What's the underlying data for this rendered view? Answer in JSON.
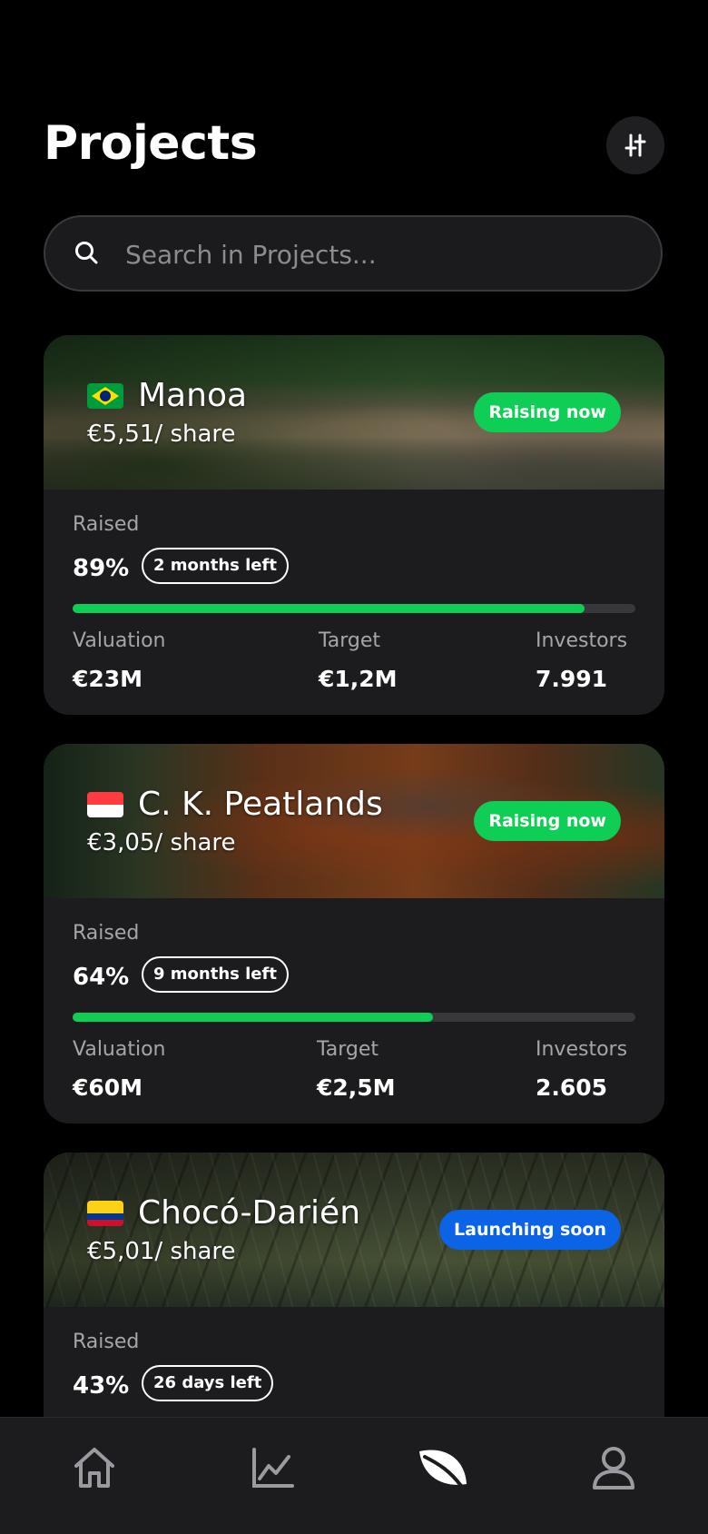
{
  "header": {
    "title": "Projects"
  },
  "search": {
    "placeholder": "Search in Projects..."
  },
  "projects": [
    {
      "name": "Manoa",
      "price": "€5,51/ share",
      "status": "Raising now",
      "status_color": "#0fce56",
      "flag": "brazil",
      "raised_label": "Raised",
      "raised_pct": "89%",
      "raised_fraction": 0.91,
      "time_left": "2 months left",
      "valuation_label": "Valuation",
      "valuation": "€23M",
      "target_label": "Target",
      "target": "€1,2M",
      "investors_label": "Investors",
      "investors": "7.991"
    },
    {
      "name": "C. K. Peatlands",
      "price": "€3,05/ share",
      "status": "Raising now",
      "status_color": "#0fce56",
      "flag": "indonesia",
      "raised_label": "Raised",
      "raised_pct": "64%",
      "raised_fraction": 0.64,
      "time_left": "9 months left",
      "valuation_label": "Valuation",
      "valuation": "€60M",
      "target_label": "Target",
      "target": "€2,5M",
      "investors_label": "Investors",
      "investors": "2.605"
    },
    {
      "name": "Chocó-Darién",
      "price": "€5,01/ share",
      "status": "Launching soon",
      "status_color": "#0b63e5",
      "flag": "colombia",
      "raised_label": "Raised",
      "raised_pct": "43%",
      "time_left": "26 days left"
    }
  ],
  "tabbar": {
    "items": [
      "home-icon",
      "chart-icon",
      "leaf-icon",
      "profile-icon"
    ],
    "active": "leaf-icon"
  },
  "colors": {
    "accent_green": "#0fce56",
    "accent_blue": "#0b63e5",
    "card_bg": "#1c1c1f"
  }
}
